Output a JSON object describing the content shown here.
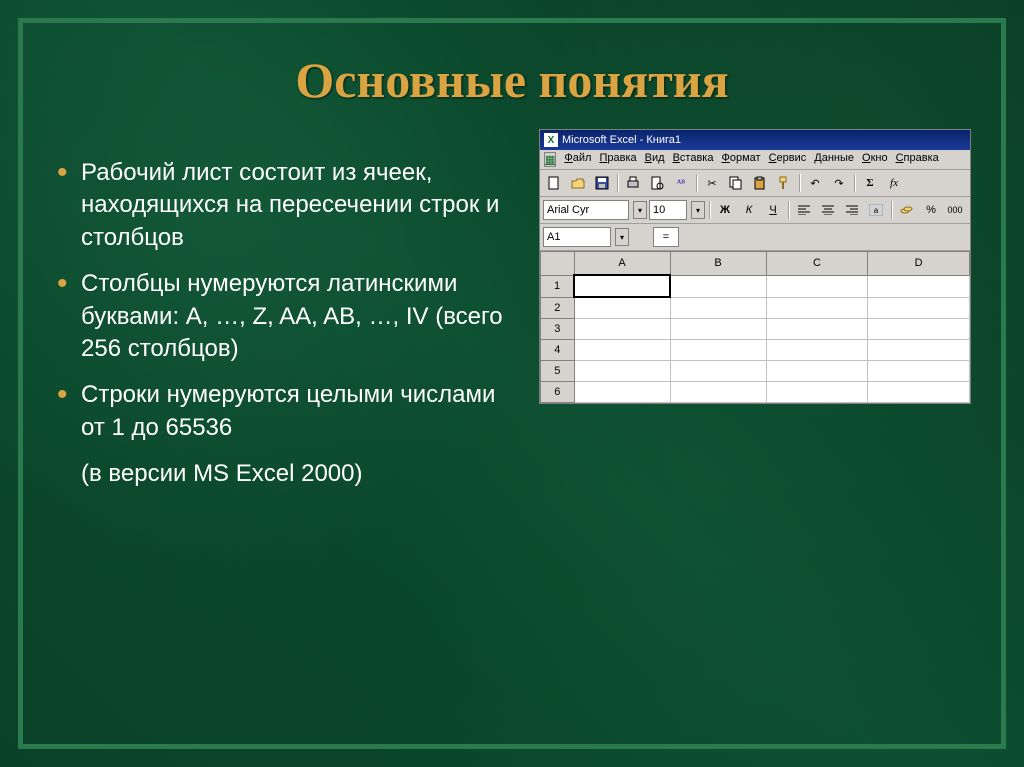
{
  "title": "Основные понятия",
  "bullets": [
    "Рабочий лист состоит из ячеек, находящихся на пересечении строк и столбцов",
    "Столбцы нумеруются латинскими буквами: A, …, Z, AA, AB, …, IV (всего 256 столбцов)",
    "Строки нумеруются целыми числами от 1 до 65536"
  ],
  "bullet_tail": "(в версии MS Excel 2000)",
  "excel": {
    "title": "Microsoft Excel - Книга1",
    "menu": [
      "Файл",
      "Правка",
      "Вид",
      "Вставка",
      "Формат",
      "Сервис",
      "Данные",
      "Окно",
      "Справка"
    ],
    "font_name": "Arial Cyr",
    "font_size": "10",
    "style_bold": "Ж",
    "style_italic": "К",
    "style_uline": "Ч",
    "percent": "%",
    "thousands": "000",
    "currency_icon": "💰",
    "sigma": "Σ",
    "fx": "fx",
    "name_box": "A1",
    "formula_eq": "=",
    "columns": [
      "A",
      "B",
      "C",
      "D"
    ],
    "rows": [
      "1",
      "2",
      "3",
      "4",
      "5",
      "6"
    ]
  }
}
